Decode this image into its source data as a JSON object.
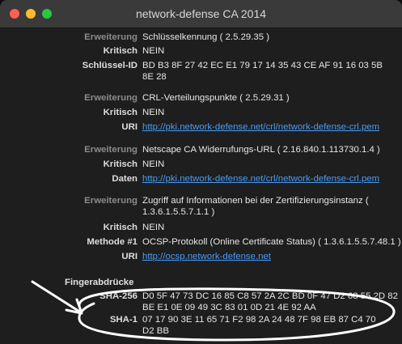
{
  "window": {
    "title": "network-defense CA 2014"
  },
  "groups": [
    {
      "label": "Erweiterung",
      "value": "Schlüsselkennung ( 2.5.29.35 )"
    },
    {
      "label": "Kritisch",
      "value": "NEIN"
    },
    {
      "label": "Schlüssel-ID",
      "value": "BD B3 8F 27 42 EC E1 79 17 14 35 43 CE AF 91 16 03 5B 8E 28"
    },
    {
      "label": "Erweiterung",
      "value": "CRL-Verteilungspunkte ( 2.5.29.31 )"
    },
    {
      "label": "Kritisch",
      "value": "NEIN"
    },
    {
      "label": "URI",
      "value": "http://pki.network-defense.net/crl/network-defense-crl.pem"
    },
    {
      "label": "Erweiterung",
      "value": "Netscape CA Widerrufungs-URL ( 2.16.840.1.113730.1.4 )"
    },
    {
      "label": "Kritisch",
      "value": "NEIN"
    },
    {
      "label": "Daten",
      "value": "http://pki.network-defense.net/crl/network-defense-crl.pem"
    },
    {
      "label": "Erweiterung",
      "value": "Zugriff auf Informationen bei der Zertifizierungsinstanz ( 1.3.6.1.5.5.7.1.1 )"
    },
    {
      "label": "Kritisch",
      "value": "NEIN"
    },
    {
      "label": "Methode #1",
      "value": "OCSP-Protokoll (Online Certificate Status) ( 1.3.6.1.5.5.7.48.1 )"
    },
    {
      "label": "URI",
      "value": "http://ocsp.network-defense.net"
    }
  ],
  "fingerprints": {
    "heading": "Fingerabdrücke",
    "sha256_label": "SHA-256",
    "sha256_value": "D0 5F 47 73 DC 16 85 C8 57 2A 2C BD 0F 47 D2 68 55 2D 82 BE E1 0E 09 49 3C 83 01 0D 21 4E 92 AA",
    "sha1_label": "SHA-1",
    "sha1_value": "07 17 90 3E 11 65 71 F2 98 2A 24 48 7F 98 EB 87 C4 70 D2 BB"
  },
  "colors": {
    "link": "#4a9cf5",
    "annotation": "#ffffff"
  }
}
